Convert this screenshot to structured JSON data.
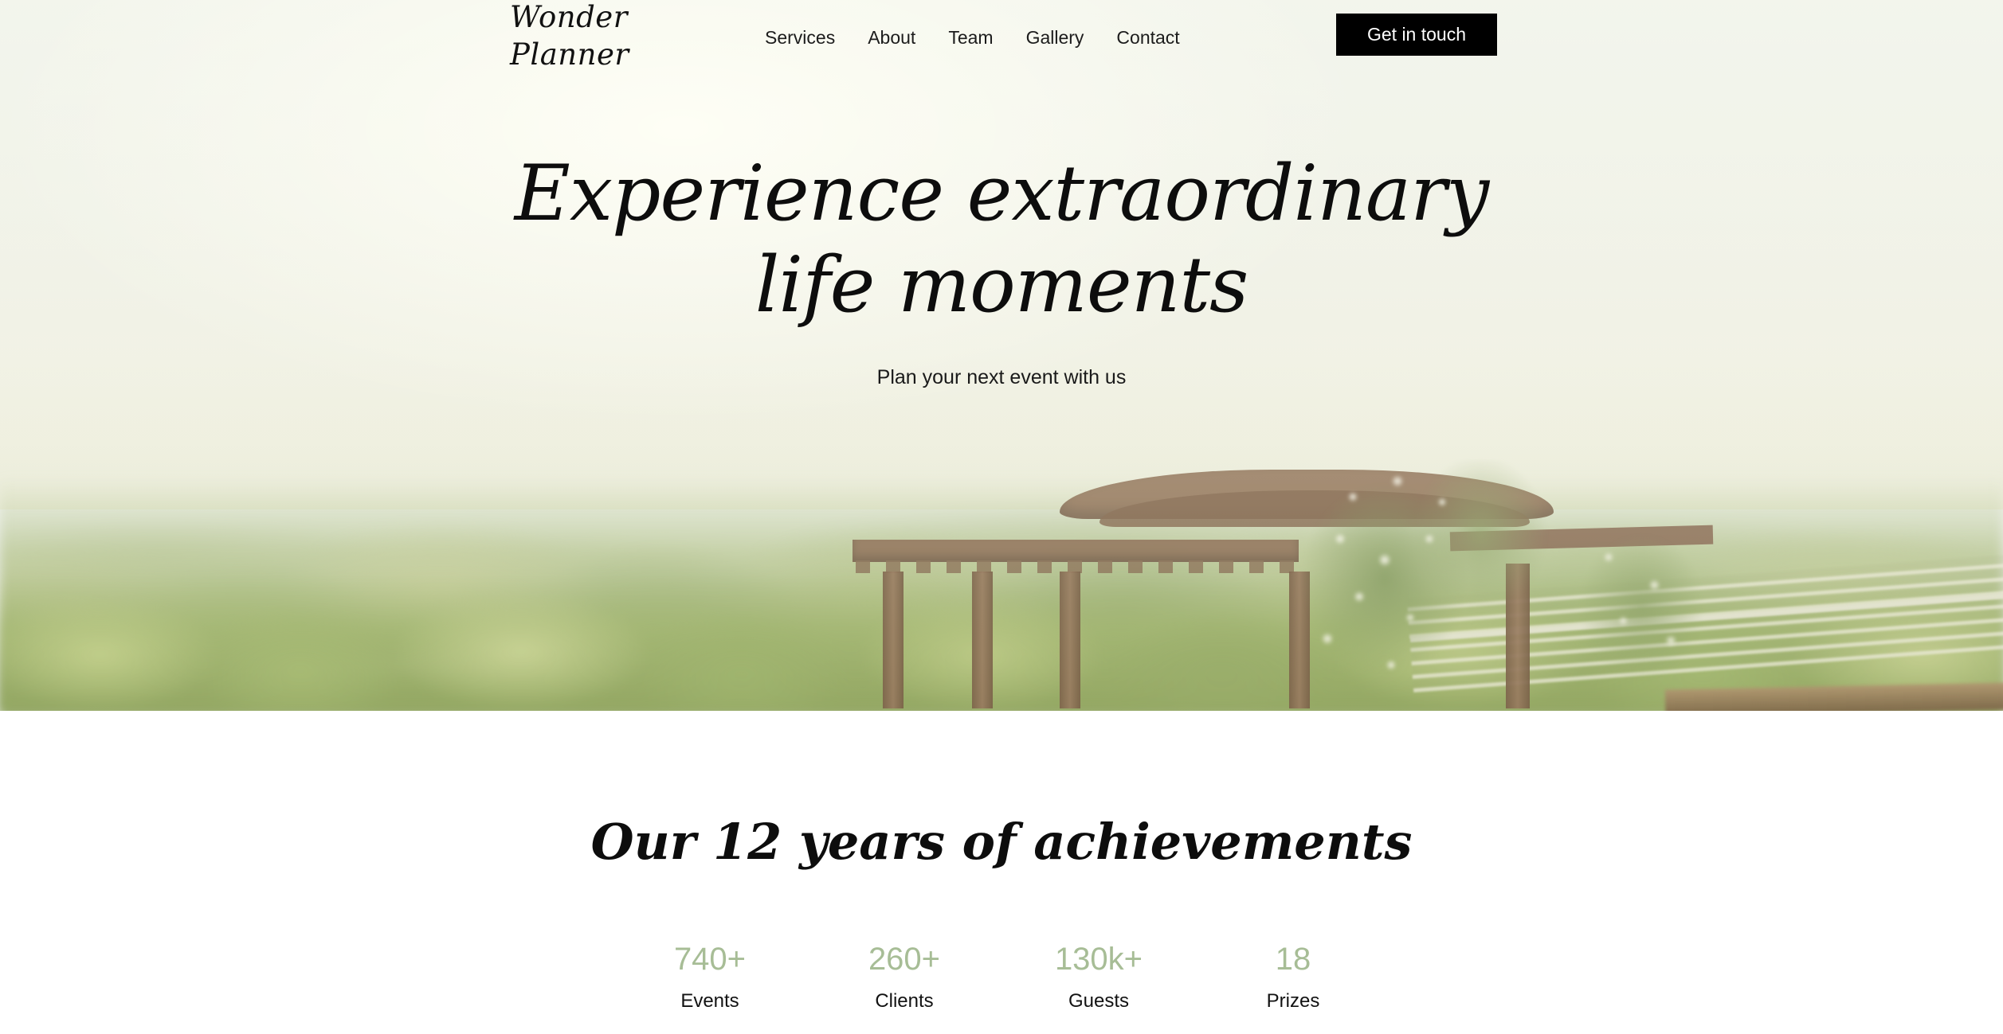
{
  "brand": {
    "logo_line1": "Wonder",
    "logo_line2": "Planner"
  },
  "header": {
    "nav": [
      {
        "label": "Services"
      },
      {
        "label": "About"
      },
      {
        "label": "Team"
      },
      {
        "label": "Gallery"
      },
      {
        "label": "Contact"
      }
    ],
    "cta_label": "Get in touch"
  },
  "hero": {
    "headline": "Experience extraordinary\nlife moments",
    "subhead": "Plan your next event with us",
    "scene": "sunlit garden pergola with white flowers over a wooded valley"
  },
  "achievements": {
    "title": "Our 12 years of achievements",
    "stats": [
      {
        "value": "740+",
        "label": "Events"
      },
      {
        "value": "260+",
        "label": "Clients"
      },
      {
        "value": "130k+",
        "label": "Guests"
      },
      {
        "value": "18",
        "label": "Prizes"
      }
    ]
  },
  "colors": {
    "page_background": "#eaeee8",
    "section_background": "#ffffff",
    "text": "#0d0d0d",
    "cta_background": "#000000",
    "cta_text": "#ffffff",
    "stat_accent": "#a7bd96"
  }
}
